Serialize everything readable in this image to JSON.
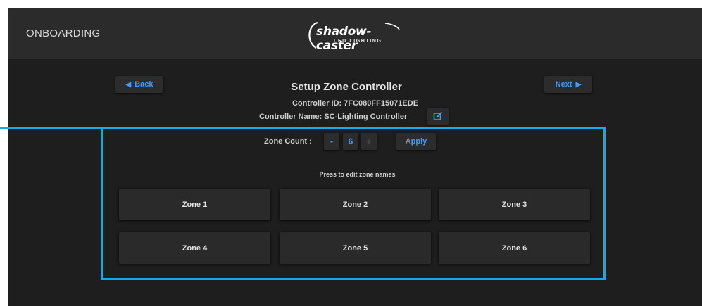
{
  "header": {
    "title": "ONBOARDING",
    "logo_brand": "shadow-caster",
    "logo_sub": "LED LIGHTING"
  },
  "nav": {
    "back_label": "Back",
    "next_label": "Next"
  },
  "setup": {
    "heading": "Setup Zone Controller",
    "controller_id": "Controller ID: 7FC080FF15071EDE",
    "controller_name": "Controller Name: SC-Lighting Controller"
  },
  "zone_count": {
    "label": "Zone Count :",
    "minus": "-",
    "value": "6",
    "plus": "+",
    "apply_label": "Apply"
  },
  "hint": "Press to edit zone names",
  "zones": [
    "Zone 1",
    "Zone 2",
    "Zone 3",
    "Zone 4",
    "Zone 5",
    "Zone 6"
  ],
  "colors": {
    "accent": "#3d9cff",
    "highlight": "#13a9ea",
    "background": "#1e1e1e",
    "topbar": "#2b2b2b"
  },
  "icons": {
    "back": "triangle-left-icon",
    "next": "triangle-right-icon",
    "edit": "edit-icon"
  }
}
